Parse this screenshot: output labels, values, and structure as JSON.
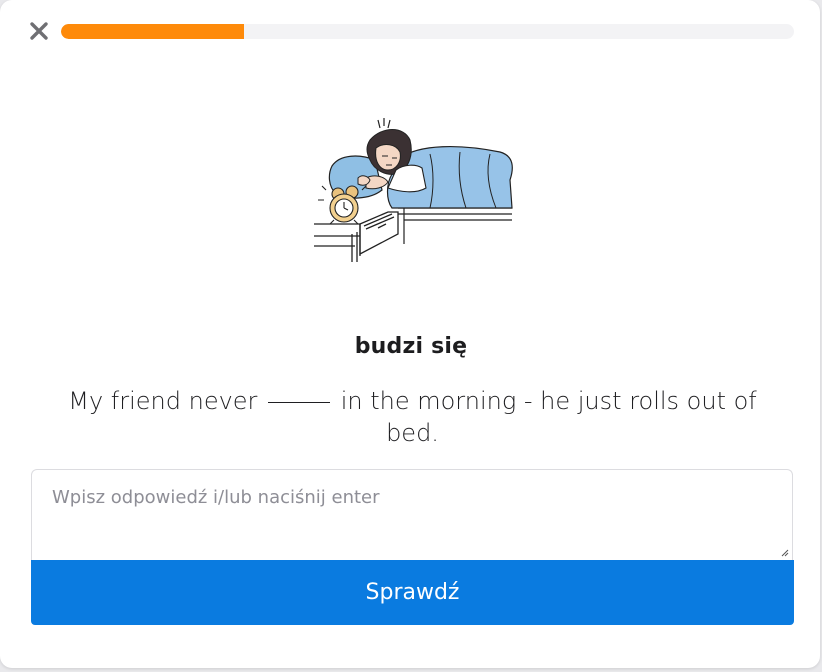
{
  "progress": {
    "value_percent": 25
  },
  "close": {
    "icon": "close-icon"
  },
  "illustration": {
    "icon": "woman-waking-up-illustration"
  },
  "exercise": {
    "word": "budzi się",
    "sentence_before": "My friend never",
    "sentence_after": "in the morning - he just rolls out of bed."
  },
  "answer": {
    "placeholder": "Wpisz odpowiedź i/lub naciśnij enter",
    "value": ""
  },
  "check_button": {
    "label": "Sprawdź"
  },
  "colors": {
    "accent": "#fe8a0a",
    "button": "#0a7be0",
    "close": "#6f6f73"
  }
}
